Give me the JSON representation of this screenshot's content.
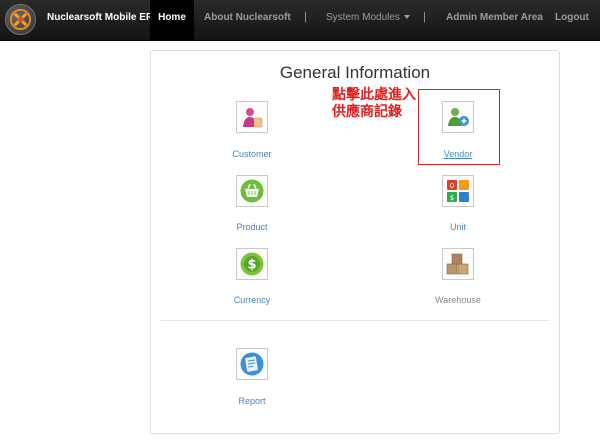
{
  "navbar": {
    "brand": "Nuclearsoft Mobile ERP",
    "items": [
      {
        "label": "Home"
      },
      {
        "label": "About Nuclearsoft"
      },
      {
        "label": "System Modules"
      },
      {
        "label": "Admin Member Area"
      },
      {
        "label": "Logout"
      }
    ],
    "separator": "|"
  },
  "panel": {
    "title": "General Information",
    "tiles": [
      {
        "label": "Customer",
        "icon": "customer-icon"
      },
      {
        "label": "Vendor",
        "icon": "vendor-icon"
      },
      {
        "label": "Product",
        "icon": "basket-icon"
      },
      {
        "label": "Unit",
        "icon": "unit-icon"
      },
      {
        "label": "Currency",
        "icon": "dollar-icon"
      },
      {
        "label": "Warehouse",
        "icon": "boxes-icon"
      },
      {
        "label": "Report",
        "icon": "report-icon"
      }
    ]
  },
  "annotation": {
    "line1": "點擊此處進入",
    "line2": "供應商記錄",
    "color": "#e0201f"
  },
  "colors": {
    "link": "#4a84c0",
    "navbar": "#222222"
  }
}
